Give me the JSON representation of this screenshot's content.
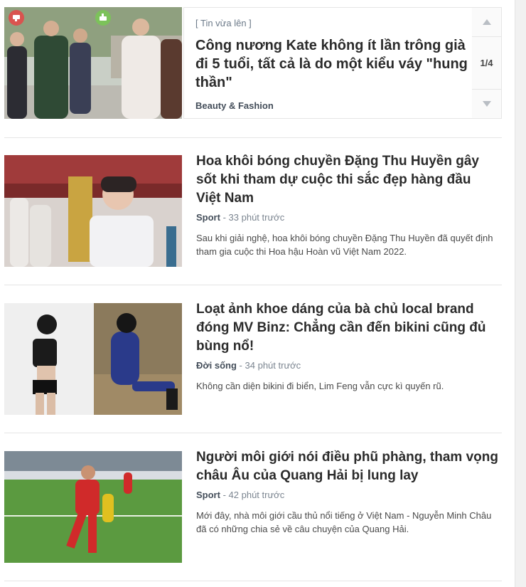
{
  "featured": {
    "tag": "[ Tin vừa lên ]",
    "title": "Công nương Kate không ít lần trông già đi 5 tuổi, tất cả là do một kiểu váy \"hung thần\"",
    "category": "Beauty & Fashion",
    "pager": {
      "current": "1/4"
    }
  },
  "articles": [
    {
      "title": "Hoa khôi bóng chuyền Đặng Thu Huyền gây sốt khi tham dự cuộc thi sắc đẹp hàng đầu Việt Nam",
      "category": "Sport",
      "separator": "-",
      "time": "33 phút trước",
      "summary": "Sau khi giải nghệ, hoa khôi bóng chuyền Đặng Thu Huyền đã quyết định tham gia cuộc thi Hoa hậu Hoàn vũ Việt Nam 2022."
    },
    {
      "title": "Loạt ảnh khoe dáng của bà chủ local brand đóng MV Binz: Chẳng cần đến bikini cũng đủ bùng nổ!",
      "category": "Đời sống",
      "separator": "-",
      "time": "34 phút trước",
      "summary": "Không cần diện bikini đi biển, Lim Feng vẫn cực kì quyến rũ."
    },
    {
      "title": "Người môi giới nói điều phũ phàng, tham vọng châu Âu của Quang Hải bị lung lay",
      "category": "Sport",
      "separator": "-",
      "time": "42 phút trước",
      "summary": "Mới đây, nhà môi giới cầu thủ nổi tiếng ở Việt Nam - Nguyễn Minh Châu đã có những chia sẻ về câu chuyện của Quang Hải."
    }
  ],
  "icons": {
    "dislike": "thumbs-down-icon",
    "like": "thumbs-up-icon",
    "up": "chevron-up-icon",
    "down": "chevron-down-icon"
  },
  "colors": {
    "dislike_badge": "#d9534f",
    "like_badge": "#7cc25a",
    "title": "#2b2b2b",
    "meta": "#7b8590"
  }
}
